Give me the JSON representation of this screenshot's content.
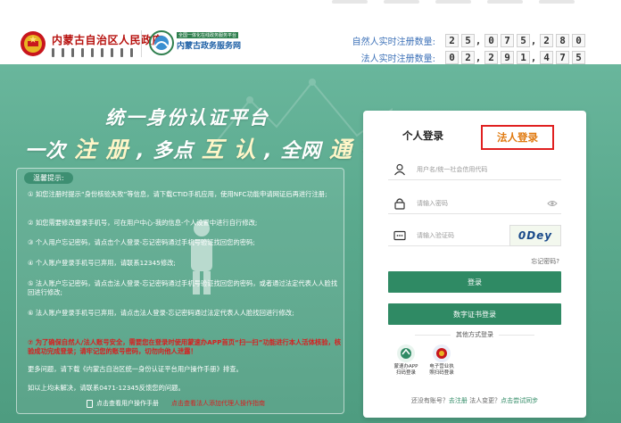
{
  "header": {
    "gov_title": "内蒙古自治区人民政府",
    "platform_sub": "全国一体化在线政务服务平台",
    "platform_name": "内蒙古政务服务网",
    "natural_label": "自然人实时注册数量:",
    "natural_digits": [
      "2",
      "5",
      ",",
      "0",
      "7",
      "5",
      ",",
      "2",
      "8",
      "0"
    ],
    "legal_label": "法人实时注册数量:",
    "legal_digits": [
      "0",
      "2",
      ",",
      "2",
      "9",
      "1",
      ",",
      "4",
      "7",
      "5"
    ]
  },
  "banner": {
    "slogan_line1": "统一身份认证平台",
    "slogan_line2_parts": [
      "一次",
      "注 册",
      ", 多点",
      "互 认",
      ", 全网",
      "通 行"
    ]
  },
  "tips": {
    "title": "温馨提示:",
    "items": [
      "① 如您注册时提示“身份核验失败”等信息，请下载CTID手机应用，使用NFC功能申请网证后再进行注册;",
      "② 如您需要修改登录手机号，可在用户中心-我的信息-个人设置中进行自行修改;",
      "③ 个人用户忘记密码，请点击个人登录-忘记密码通过手机号验证找回您的密码;",
      "④ 个人账户登录手机号已弃用，请联系12345修改;",
      "⑤ 法人账户忘记密码，请点击法人登录-忘记密码通过手机号验证找回您的密码，或者通过法定代表人人脸找回进行修改;",
      "⑥ 法人账户登录手机号已弃用，请点击法人登录-忘记密码通过法定代表人人脸找回进行修改;",
      "⑦ 为了确保自然人/法人账号安全，需要您在登录时使用蒙速办APP首页“扫一扫”功能进行本人活体核验，核验成功完成登录；请牢记您的账号密码，切勿向他人泄露！",
      "更多问题，请下载《内蒙古自治区统一身份认证平台用户操作手册》排查。",
      "如以上均未解决，请联系0471-12345反馈您的问题。"
    ],
    "link_user_manual": "点击查看用户操作手册",
    "link_agent_guide": "点击查看法人添加代理人操作指南"
  },
  "login": {
    "tab_personal": "个人登录",
    "tab_legal": "法人登录",
    "username_placeholder": "用户名/统一社会信用代码",
    "password_placeholder": "请输入密码",
    "captcha_placeholder": "请输入验证码",
    "captcha_text": "0Dey",
    "forgot": "忘记密码?",
    "login_button": "登录",
    "cert_button": "数字证书登录",
    "other_methods": "其他方式登录",
    "alt1_label": "蒙速办APP\n扫码登录",
    "alt2_label": "电子营业执\n照扫码登录",
    "no_account": "还没有账号？",
    "register": "去注册",
    "legal_change": "法人变更？",
    "sync": "点击尝试同步"
  },
  "colors": {
    "banner_green": "#5aa98d",
    "button_green": "#2f8a64",
    "highlight_red": "#e02020",
    "legal_tab_orange": "#e07a10",
    "gov_red": "#b7120f",
    "counter_blue": "#3e72b8"
  },
  "icons": [
    "national-emblem-icon",
    "platform-logo-icon",
    "user-icon",
    "lock-icon",
    "eye-icon",
    "captcha-field-icon",
    "document-icon",
    "mengsuban-app-icon",
    "business-license-icon"
  ]
}
